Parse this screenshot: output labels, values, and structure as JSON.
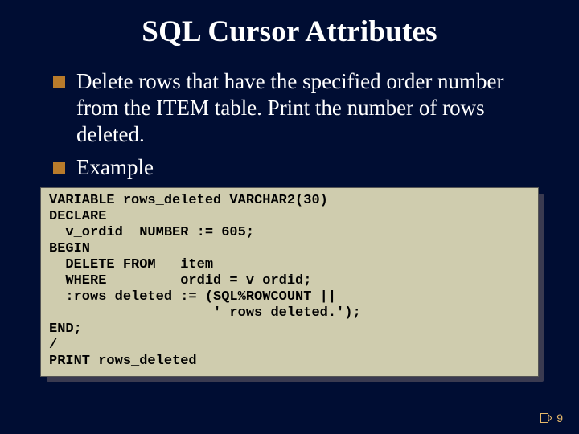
{
  "title": "SQL Cursor Attributes",
  "bullets": [
    "Delete rows that have the specified order number from the ITEM table. Print the number of rows deleted.",
    "Example"
  ],
  "code": "VARIABLE rows_deleted VARCHAR2(30)\nDECLARE\n  v_ordid  NUMBER := 605;\nBEGIN\n  DELETE FROM   item\n  WHERE         ordid = v_ordid;\n  :rows_deleted := (SQL%ROWCOUNT ||\n                    ' rows deleted.');\nEND;\n/\nPRINT rows_deleted",
  "page_number": "9"
}
